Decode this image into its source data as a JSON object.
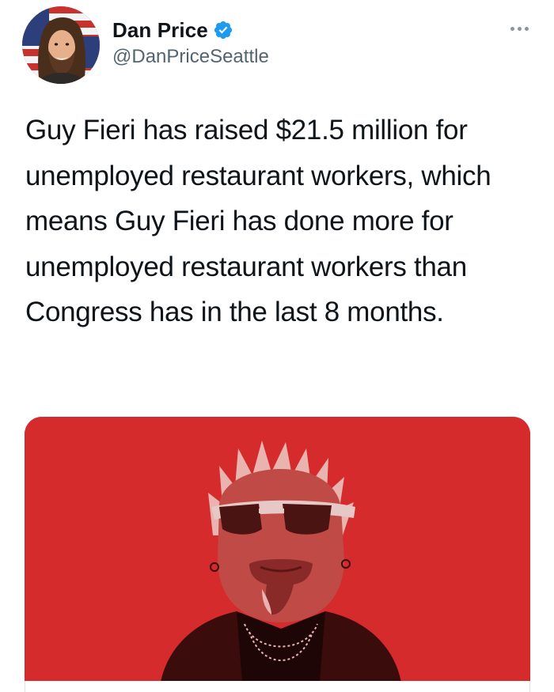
{
  "author": {
    "display_name": "Dan Price",
    "handle": "@DanPriceSeattle",
    "verified": true
  },
  "tweet": {
    "text": "Guy Fieri has raised $21.5 million for unemployed restaurant workers, which means Guy Fieri has done more for unemployed restaurant workers than Congress has in the last 8 months."
  },
  "icons": {
    "verified": "verified-badge-icon",
    "more": "more-options-icon"
  },
  "colors": {
    "verified_blue": "#1d9bf0",
    "media_red": "#d52b2c",
    "handle_gray": "#536471"
  }
}
